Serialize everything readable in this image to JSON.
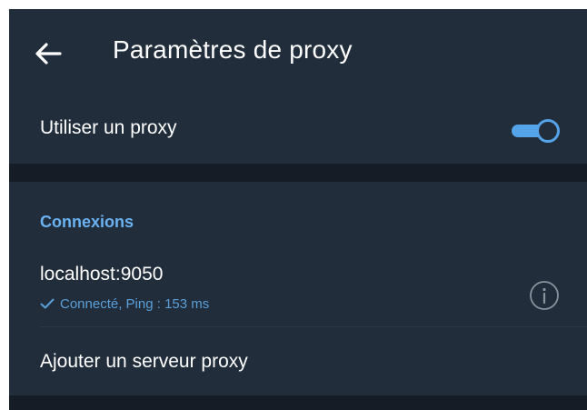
{
  "app_bar": {
    "title": "Paramètres de proxy",
    "back_icon": "arrow-left-icon"
  },
  "use_proxy": {
    "label": "Utiliser un proxy",
    "enabled": true
  },
  "connections": {
    "header": "Connexions",
    "items": [
      {
        "address": "localhost:9050",
        "status": "Connecté, Ping : 153 ms",
        "status_icon": "checkmark-icon",
        "action_icon": "info-icon"
      }
    ],
    "add_label": "Ajouter un serveur proxy"
  },
  "colors": {
    "background": "#1c242f",
    "surface": "#212d3b",
    "accent": "#55a3e8",
    "section_header": "#6ab2f2",
    "status_text": "#5b9fd9",
    "text_primary": "#ffffff"
  }
}
